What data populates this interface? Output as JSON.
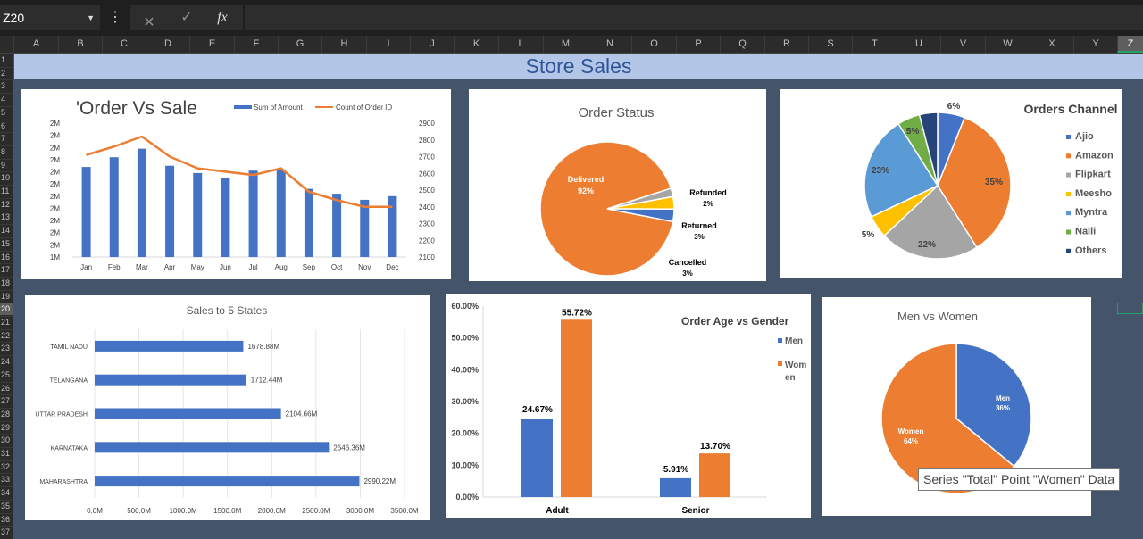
{
  "formula_bar": {
    "name_box": "Z20",
    "dots": "⋮",
    "cancel_icon": "✕",
    "enter_icon": "✓",
    "fx_label": "fx",
    "formula": ""
  },
  "columns": [
    "A",
    "B",
    "C",
    "D",
    "E",
    "F",
    "G",
    "H",
    "I",
    "J",
    "K",
    "L",
    "M",
    "N",
    "O",
    "P",
    "Q",
    "R",
    "S",
    "T",
    "U",
    "V",
    "W",
    "X",
    "Y",
    "Z"
  ],
  "selected_column": "Z",
  "rows": [
    "1",
    "2",
    "3",
    "4",
    "5",
    "6",
    "7",
    "8",
    "9",
    "10",
    "11",
    "12",
    "13",
    "14",
    "15",
    "16",
    "17",
    "18",
    "19",
    "20",
    "21",
    "22",
    "23",
    "24",
    "25",
    "26",
    "27",
    "28",
    "29",
    "30",
    "31",
    "32",
    "33",
    "34",
    "35",
    "36",
    "37"
  ],
  "selected_row": "20",
  "dashboard_title": "Store Sales",
  "tooltip": "Series \"Total\" Point \"Women\" Data",
  "colors": {
    "blue": "#4472c4",
    "orange": "#ed7d31",
    "gray": "#a5a5a5",
    "yellow": "#ffc000",
    "lightblue": "#5b9bd5",
    "green": "#70ad47",
    "navy": "#264478"
  },
  "charts": {
    "order_vs_sale": {
      "title": "'Order Vs Sale",
      "legend": [
        "Sum of Amount",
        "Count of Order ID"
      ],
      "y_left_ticks": [
        "2M",
        "2M",
        "2M",
        "2M",
        "2M",
        "2M",
        "2M",
        "2M",
        "2M",
        "2M",
        "2M",
        "1M"
      ],
      "y_right_ticks": [
        "2900",
        "2800",
        "2700",
        "2600",
        "2500",
        "2400",
        "2300",
        "2200",
        "2100"
      ],
      "months": [
        "Jan",
        "Feb",
        "Mar",
        "Apr",
        "May",
        "Jun",
        "Jul",
        "Aug",
        "Sep",
        "Oct",
        "Nov",
        "Dec"
      ],
      "amount": [
        1.74,
        1.82,
        1.89,
        1.75,
        1.69,
        1.65,
        1.71,
        1.72,
        1.56,
        1.52,
        1.47,
        1.5
      ],
      "orders": [
        2710,
        2760,
        2820,
        2700,
        2630,
        2610,
        2590,
        2630,
        2490,
        2440,
        2400,
        2400
      ],
      "amount_range": [
        1.0,
        2.1
      ],
      "orders_range": [
        2100,
        2900
      ]
    },
    "order_status": {
      "title": "Order Status",
      "slices": [
        {
          "label": "Delivered",
          "pct": "92%",
          "value": 92
        },
        {
          "label": "Refunded",
          "pct": "2%",
          "value": 2
        },
        {
          "label": "Returned",
          "pct": "3%",
          "value": 3
        },
        {
          "label": "Cancelled",
          "pct": "3%",
          "value": 3
        }
      ]
    },
    "orders_channel": {
      "title": "Orders Channel",
      "slices": [
        {
          "label": "Ajio",
          "pct": "6%",
          "value": 6
        },
        {
          "label": "Amazon",
          "pct": "35%",
          "value": 35
        },
        {
          "label": "Flipkart",
          "pct": "22%",
          "value": 22
        },
        {
          "label": "Meesho",
          "pct": "5%",
          "value": 5
        },
        {
          "label": "Myntra",
          "pct": "23%",
          "value": 23
        },
        {
          "label": "Nalli",
          "pct": "5%",
          "value": 5
        },
        {
          "label": "Others",
          "pct": "",
          "value": 4
        }
      ]
    },
    "sales_states": {
      "title": "Sales to 5 States",
      "states": [
        "TAMIL NADU",
        "TELANGANA",
        "UTTAR PRADESH",
        "KARNATAKA",
        "MAHARASHTRA"
      ],
      "values": [
        1678.88,
        1712.44,
        2104.66,
        2646.36,
        2990.22
      ],
      "labels": [
        "1678.88M",
        "1712.44M",
        "2104.66M",
        "2646.36M",
        "2990.22M"
      ],
      "x_ticks": [
        "0.0M",
        "500.0M",
        "1000.0M",
        "1500.0M",
        "2000.0M",
        "2500.0M",
        "3000.0M",
        "3500.0M"
      ],
      "x_max": 3500
    },
    "age_gender": {
      "title": "Order Age vs Gender",
      "legend": [
        "Men",
        "Wom",
        "en"
      ],
      "categories": [
        "Adult",
        "Senior"
      ],
      "men": [
        24.67,
        5.91
      ],
      "women": [
        55.72,
        13.7
      ],
      "men_labels": [
        "24.67%",
        "5.91%"
      ],
      "women_labels": [
        "55.72%",
        "13.70%"
      ],
      "y_ticks": [
        "0.00%",
        "10.00%",
        "20.00%",
        "30.00%",
        "40.00%",
        "50.00%",
        "60.00%"
      ],
      "y_max": 60
    },
    "men_women": {
      "title": "Men vs Women",
      "slices": [
        {
          "label": "Men",
          "pct": "36%",
          "value": 36
        },
        {
          "label": "Women",
          "pct": "64%",
          "value": 64
        }
      ]
    }
  }
}
